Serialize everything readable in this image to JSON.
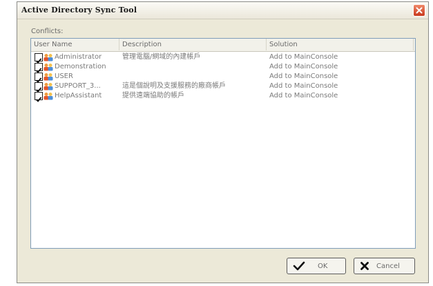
{
  "window": {
    "title": "Active Directory Sync Tool"
  },
  "conflicts_label": "Conflicts:",
  "columns": [
    "User Name",
    "Description",
    "Solution"
  ],
  "rows": [
    {
      "user": "Administrator",
      "description": "管理電腦/網域的內建帳戶",
      "solution": "Add to MainConsole"
    },
    {
      "user": "Demonstration",
      "description": "",
      "solution": "Add to MainConsole"
    },
    {
      "user": "USER",
      "description": "",
      "solution": "Add to MainConsole"
    },
    {
      "user": "SUPPORT_3...",
      "description": "這是個說明及支援服務的廠商帳戶",
      "solution": "Add to MainConsole"
    },
    {
      "user": "HelpAssistant",
      "description": "提供遠端協助的帳戶",
      "solution": "Add to MainConsole"
    }
  ],
  "buttons": {
    "ok": "OK",
    "cancel": "Cancel"
  },
  "icons": {
    "close": "close-icon",
    "checkbox": "checkbox-checked-icon",
    "user": "user-group-icon",
    "ok": "checkmark-icon",
    "cancel": "x-icon"
  }
}
